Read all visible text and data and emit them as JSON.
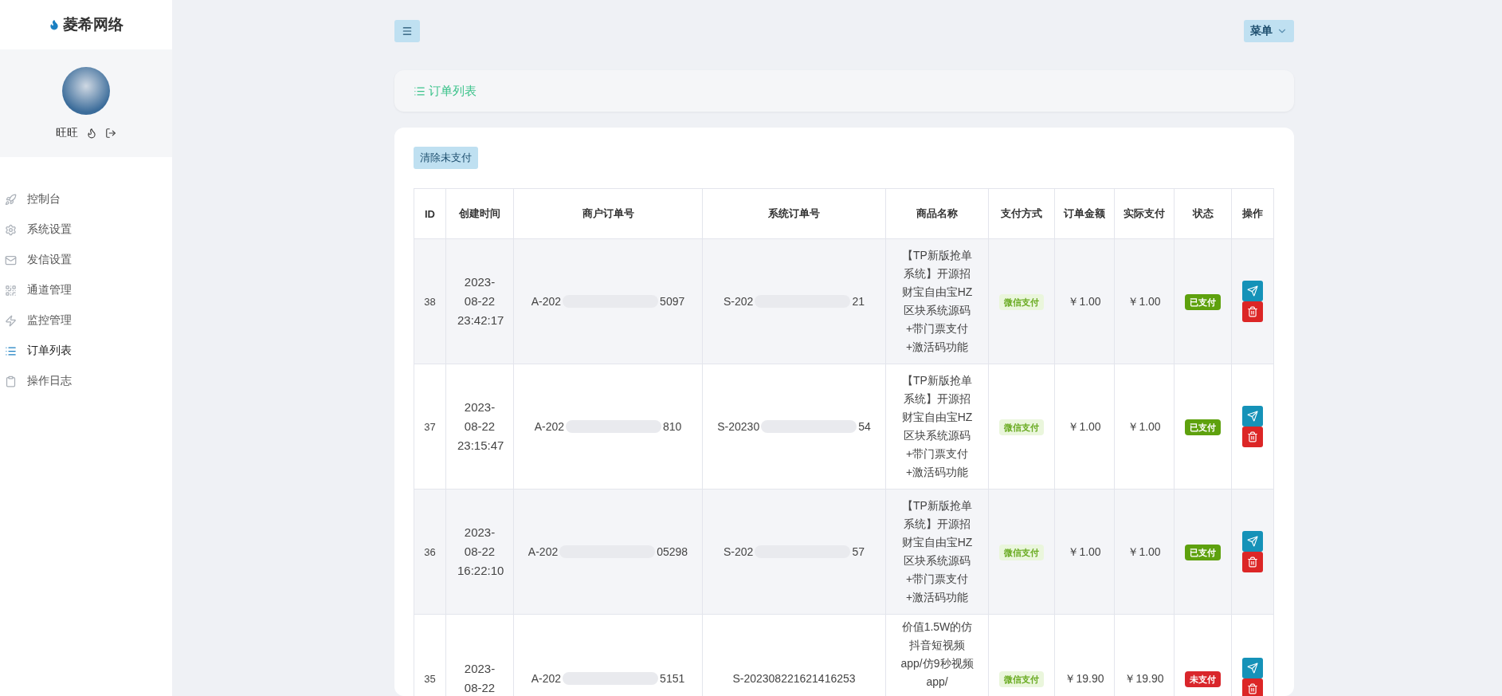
{
  "brand": "菱希网络",
  "user": {
    "name": "旺旺"
  },
  "nav": [
    {
      "label": "控制台",
      "selected": false
    },
    {
      "label": "系统设置",
      "selected": false
    },
    {
      "label": "发信设置",
      "selected": false
    },
    {
      "label": "通道管理",
      "selected": false
    },
    {
      "label": "监控管理",
      "selected": false
    },
    {
      "label": "订单列表",
      "selected": true
    },
    {
      "label": "操作日志",
      "selected": false
    }
  ],
  "topbar": {
    "menu_label": "菜单"
  },
  "page_title": "订单列表",
  "clear_button": "清除未支付",
  "table": {
    "columns": [
      "ID",
      "创建时间",
      "商户订单号",
      "系统订单号",
      "商品名称",
      "支付方式",
      "订单金额",
      "实际支付",
      "状态",
      "操作"
    ],
    "rows": [
      {
        "id": "38",
        "created": "2023-08-22 23:42:17",
        "merchant_order": {
          "start": "A-202",
          "end": "5097"
        },
        "system_order": {
          "start": "S-202",
          "end": "21"
        },
        "product": "【TP新版抢单系统】开源招财宝自由宝HZ区块系统源码+带门票支付+激活码功能",
        "method": "微信支付",
        "amount": "￥1.00",
        "paid": "￥1.00",
        "status": {
          "label": "已支付",
          "kind": "paid"
        }
      },
      {
        "id": "37",
        "created": "2023-08-22 23:15:47",
        "merchant_order": {
          "start": "A-202",
          "end": "810"
        },
        "system_order": {
          "start": "S-20230",
          "end": "54"
        },
        "product": "【TP新版抢单系统】开源招财宝自由宝HZ区块系统源码+带门票支付+激活码功能",
        "method": "微信支付",
        "amount": "￥1.00",
        "paid": "￥1.00",
        "status": {
          "label": "已支付",
          "kind": "paid"
        }
      },
      {
        "id": "36",
        "created": "2023-08-22 16:22:10",
        "merchant_order": {
          "start": "A-202",
          "end": "05298"
        },
        "system_order": {
          "start": "S-202",
          "end": "57"
        },
        "product": "【TP新版抢单系统】开源招财宝自由宝HZ区块系统源码+带门票支付+激活码功能",
        "method": "微信支付",
        "amount": "￥1.00",
        "paid": "￥1.00",
        "status": {
          "label": "已支付",
          "kind": "paid"
        }
      },
      {
        "id": "35",
        "created": "2023-08-22",
        "merchant_order": {
          "start": "A-202",
          "end": "5151"
        },
        "system_order": {
          "start": "S-202308221621416253"
        },
        "product": "价值1.5W的仿抖音短视频app/仿9秒视频app/",
        "method": "微信支付",
        "amount": "￥19.90",
        "paid": "￥19.90",
        "status": {
          "label": "未支付",
          "kind": "unpaid"
        }
      }
    ]
  }
}
